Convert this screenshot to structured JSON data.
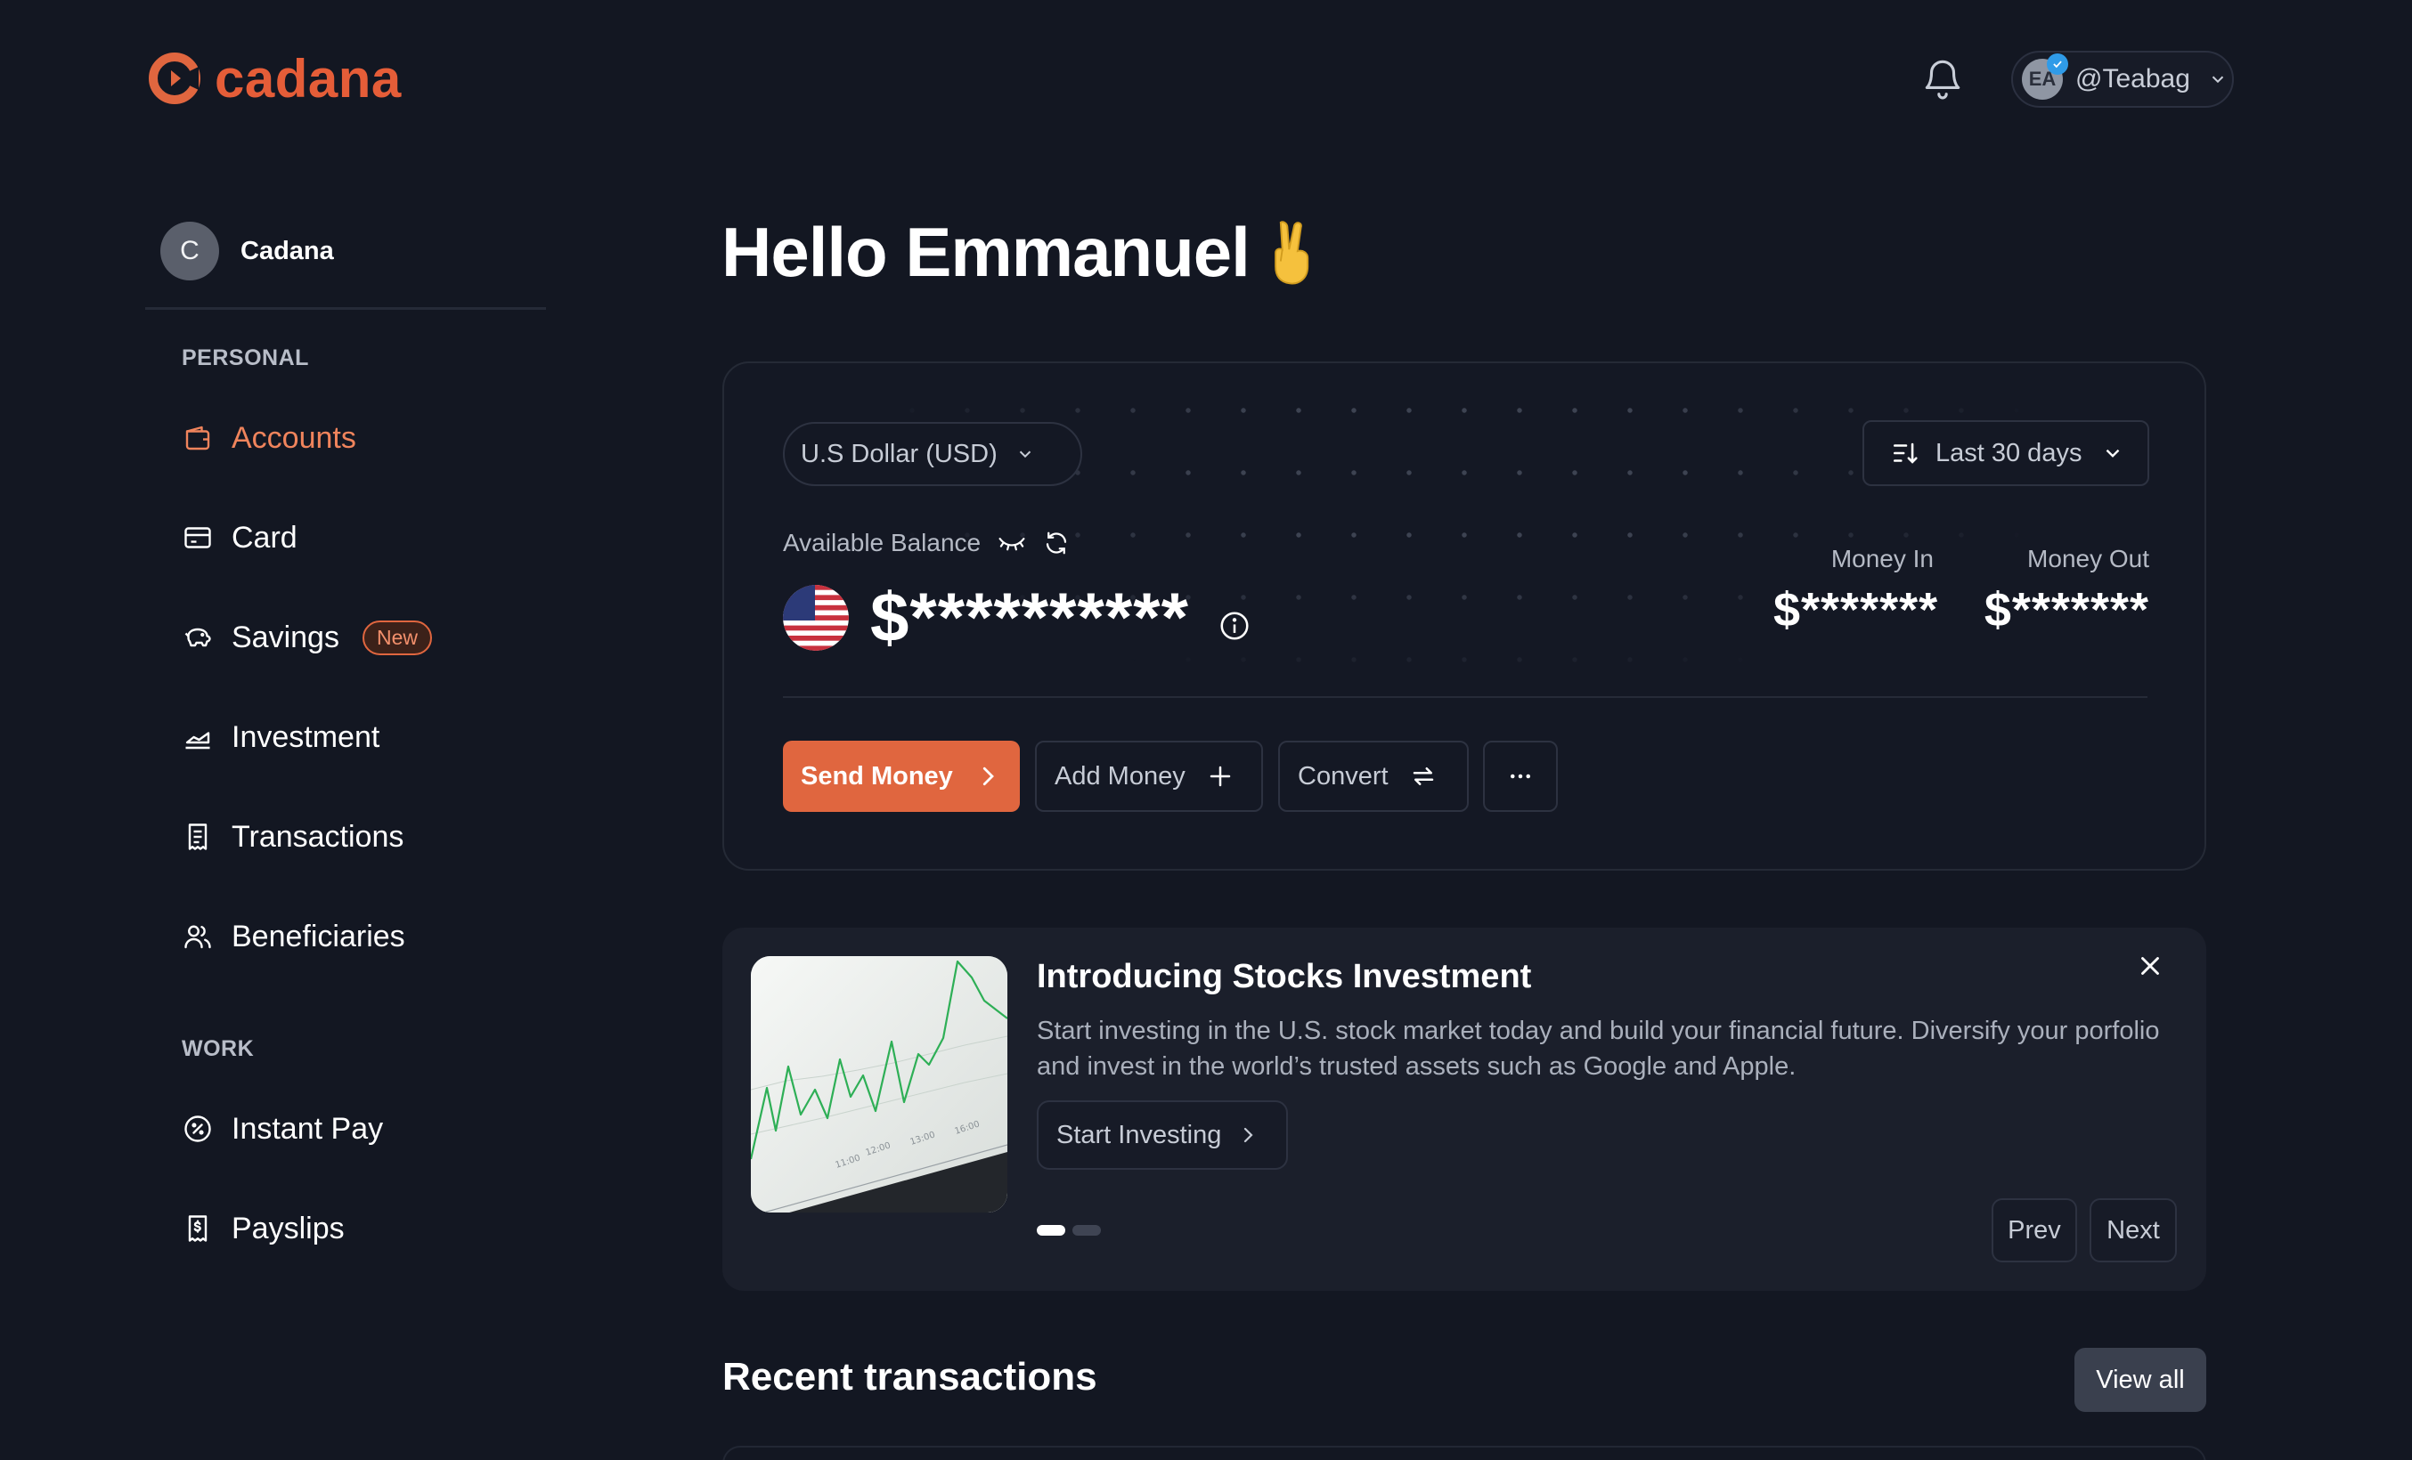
{
  "brand": {
    "name": "cadana",
    "accent": "#e0663f"
  },
  "header": {
    "user_handle": "@Teabag",
    "user_initials": "EA"
  },
  "sidebar": {
    "org_initial": "C",
    "org_name": "Cadana",
    "personal_label": "PERSONAL",
    "work_label": "WORK",
    "personal_items": [
      {
        "label": "Accounts",
        "icon": "wallet-icon",
        "active": true
      },
      {
        "label": "Card",
        "icon": "card-icon"
      },
      {
        "label": "Savings",
        "icon": "piggy-bank-icon",
        "badge": "New"
      },
      {
        "label": "Investment",
        "icon": "chart-icon"
      },
      {
        "label": "Transactions",
        "icon": "receipt-icon"
      },
      {
        "label": "Beneficiaries",
        "icon": "users-icon"
      }
    ],
    "work_items": [
      {
        "label": "Instant Pay",
        "icon": "percent-badge-icon"
      },
      {
        "label": "Payslips",
        "icon": "payslip-icon"
      }
    ]
  },
  "main": {
    "greeting": "Hello Emmanuel",
    "greeting_emoji": "victory-hand-icon",
    "balance_card": {
      "currency": "U.S Dollar (USD)",
      "period": "Last 30 days",
      "available_label": "Available Balance",
      "balance": "$**********",
      "money_in_label": "Money In",
      "money_in_value": "$*******",
      "money_out_label": "Money Out",
      "money_out_value": "$*******",
      "actions": {
        "send": "Send Money",
        "add": "Add Money",
        "convert": "Convert"
      }
    },
    "promo": {
      "title": "Introducing Stocks Investment",
      "description": "Start investing in the U.S. stock market today and build your financial future. Diversify your porfolio and invest in the world’s trusted assets such as Google and Apple.",
      "cta": "Start Investing",
      "prev": "Prev",
      "next": "Next",
      "image_tick_labels": [
        "13:00",
        "12:00",
        "11:00",
        "16:00"
      ]
    },
    "recent": {
      "title": "Recent transactions",
      "view_all": "View all"
    }
  }
}
